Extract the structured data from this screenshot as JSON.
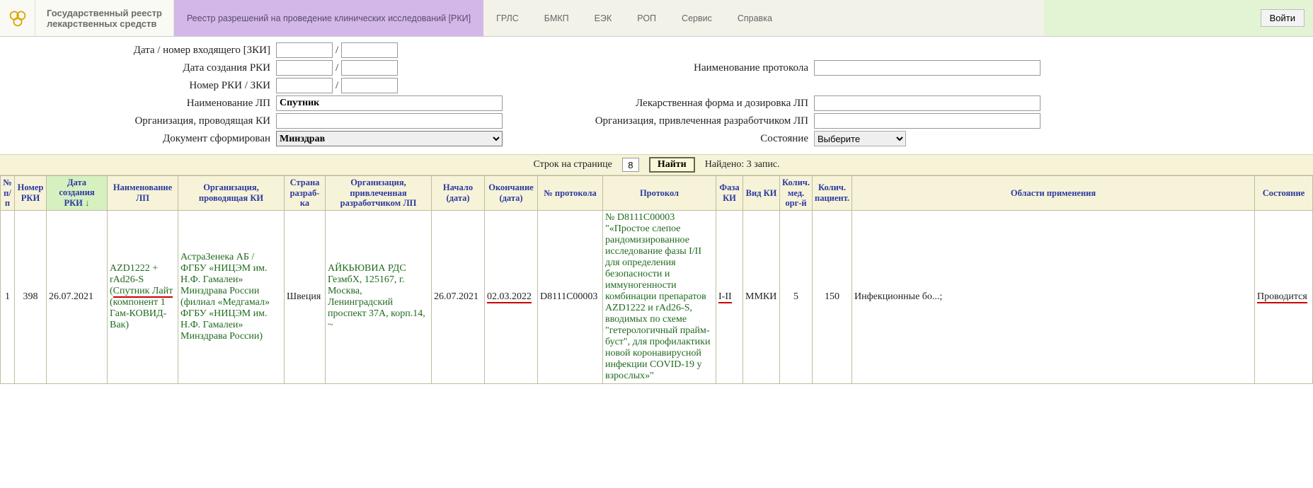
{
  "brand": {
    "line1": "Государственный реестр",
    "line2": "лекарственных средств"
  },
  "tabs": {
    "active": "Реестр разрешений на проведение клинических исследований [РКИ]",
    "items": [
      "ГРЛС",
      "БМКП",
      "ЕЭК",
      "РОП",
      "Сервис",
      "Справка"
    ]
  },
  "login": "Войти",
  "filters": {
    "incoming_label": "Дата / номер входящего [ЗКИ]",
    "rki_create_label": "Дата создания РКИ",
    "rki_num_label": "Номер РКИ / ЗКИ",
    "lp_name_label": "Наименование ЛП",
    "lp_name_value": "Спутник",
    "org_ki_label": "Организация, проводящая КИ",
    "doc_formed_label": "Документ сформирован",
    "doc_formed_value": "Минздрав",
    "protocol_name_label": "Наименование протокола",
    "lp_form_label": "Лекарственная форма и дозировка ЛП",
    "org_dev_label": "Организация, привлеченная разработчиком ЛП",
    "state_label": "Состояние",
    "state_value": "Выберите"
  },
  "pager": {
    "rows_label": "Строк на странице",
    "rows_value": "8",
    "find": "Найти",
    "found": "Найдено: 3 запис."
  },
  "columns": [
    "№ п/п",
    "Номер РКИ",
    "Дата создания РКИ",
    "Наименование ЛП",
    "Организация, проводящая КИ",
    "Страна разраб-ка",
    "Организация, привлеченная разработчиком ЛП",
    "Начало (дата)",
    "Окончание (дата)",
    "№ протокола",
    "Протокол",
    "Фаза КИ",
    "Вид КИ",
    "Колич. мед. орг-й",
    "Колич. пациент.",
    "Области применения",
    "Состояние"
  ],
  "row": {
    "n": "1",
    "rki_num": "398",
    "rki_date": "26.07.2021",
    "lp_name": "AZD1222 + rAd26-S (Спутник Лайт (компонент 1 Гам-КОВИД-Вак)",
    "lp_name_u": "Спутник Лайт",
    "org_ki": "АстраЗенека АБ / ФГБУ «НИЦЭМ им. Н.Ф. Гамалеи» Минздрава России (филиал «Медгамал» ФГБУ «НИЦЭМ им. Н.Ф. Гамалеи» Минздрава России)",
    "country": "Швеция",
    "org_dev": "АЙКЬЮВИА РДС ГезмбХ, 125167, г. Москва, Ленинградский проспект 37А, корп.14, ~",
    "start": "26.07.2021",
    "end": "02.03.2022",
    "proto_num": "D8111C00003",
    "protocol": "№ D8111C00003 \"«Простое слепое рандомизированное исследование фазы I/II для определения безопасности и иммуногенности комбинации препаратов AZD1222 и rAd26-S, вводимых по схеме \"гетерологичный прайм-буст\", для профилактики новой коронавирусной инфекции COVID-19 у взрослых»\"",
    "phase": "I-II",
    "kind": "ММКИ",
    "med_orgs": "5",
    "patients": "150",
    "area": "Инфекционные бо...;",
    "state": "Проводится"
  }
}
